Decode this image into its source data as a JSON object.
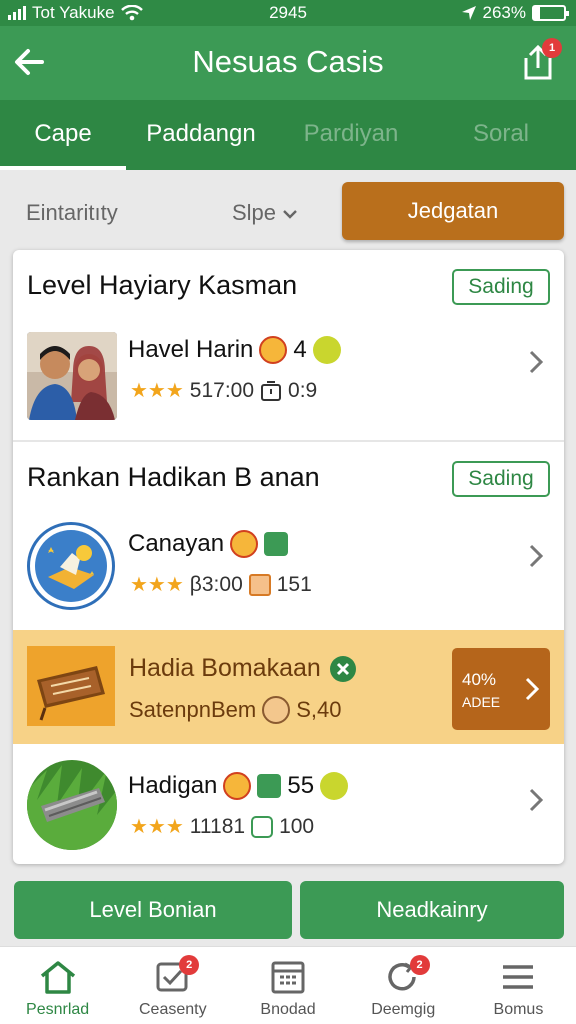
{
  "status_bar": {
    "carrier": "Tot Yakuke",
    "time": "2945",
    "battery": "263%",
    "battery_level": 0.2
  },
  "header": {
    "title": "Nesuas Casis",
    "share_badge": "1"
  },
  "tabs": [
    {
      "label": "Cape",
      "active": true
    },
    {
      "label": "Paddangn",
      "active": false
    },
    {
      "label": "Pardiyan",
      "active": false
    },
    {
      "label": "Soral",
      "active": false
    }
  ],
  "filters": {
    "filter1": "Eintaritıty",
    "filter2": "Slpe",
    "action": "Jedgatan"
  },
  "sections": [
    {
      "title": "Level Hayiary Kasman",
      "tag": "Sading",
      "item": {
        "name": "Havel Harin",
        "count": "4",
        "rating": "3",
        "stars": "★★★",
        "value": "517:00",
        "stat": "0:9"
      }
    },
    {
      "title": "Rankan Hadikan B anan",
      "tag": "Sading",
      "item": {
        "name": "Canayan",
        "rating": "2.5",
        "stars": "★★★",
        "value": "β3:00",
        "stat": "151"
      }
    }
  ],
  "promo": {
    "name": "Hadia Bomakaan",
    "subtitle": "SatenpnBem",
    "amount": "S,40",
    "percent": "40%",
    "cta": "ADEE"
  },
  "last_item": {
    "name": "Hadigan",
    "count": "55",
    "rating": "2.5",
    "stars": "★★★",
    "value": "11181",
    "stat": "100"
  },
  "buttons": {
    "left": "Level Bonian",
    "right": "Neadkainry"
  },
  "nav": [
    {
      "label": "Pesnrlad",
      "icon": "home-icon",
      "active": true
    },
    {
      "label": "Ceasenty",
      "icon": "check-box-icon",
      "badge": "2"
    },
    {
      "label": "Bnodad",
      "icon": "calendar-icon"
    },
    {
      "label": "Deemgig",
      "icon": "refresh-icon",
      "badge": "2"
    },
    {
      "label": "Bomus",
      "icon": "menu-icon"
    }
  ],
  "colors": {
    "primary": "#3c9a55",
    "primary_dark": "#2e8744",
    "accent": "#b96f1c",
    "promo_bg": "#f7d287"
  }
}
